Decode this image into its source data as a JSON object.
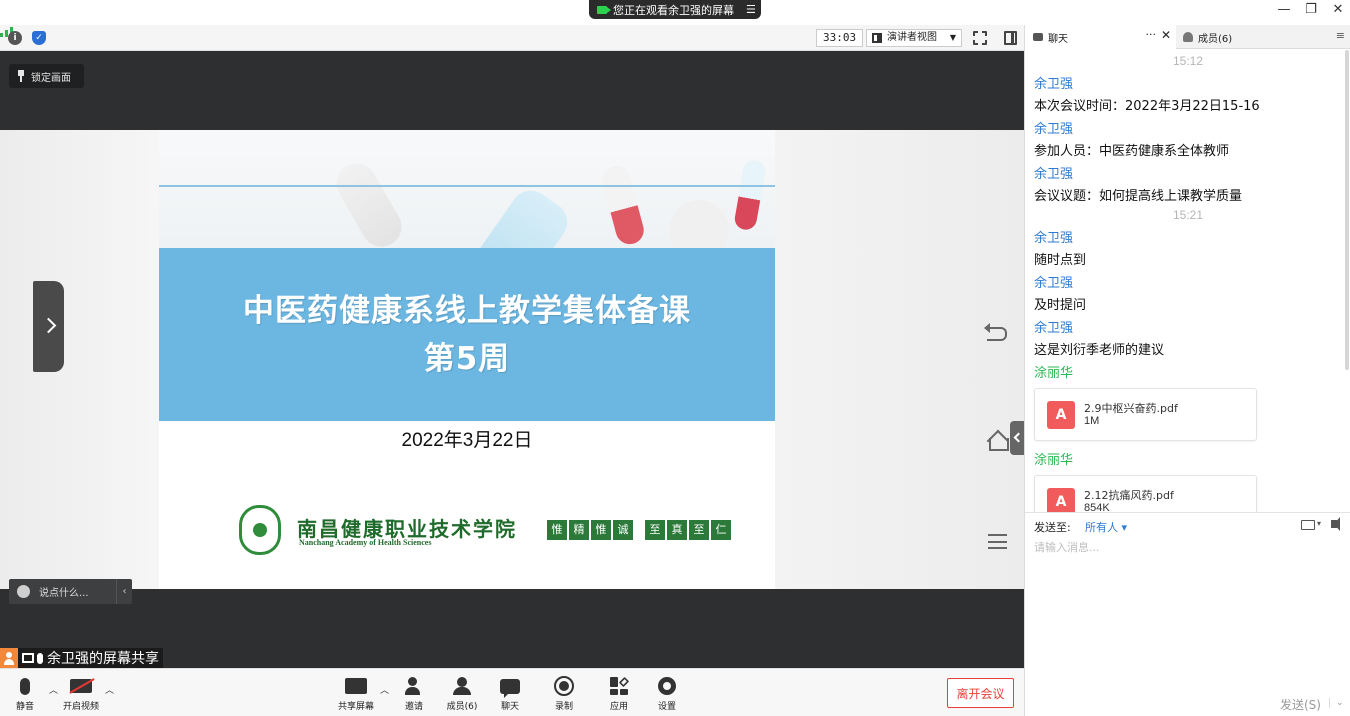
{
  "titlebar": {
    "viewing_text": "您正在观看余卫强的屏幕",
    "minimize": "—",
    "restore": "❐",
    "close": "✕"
  },
  "toolbar": {
    "timer": "33:03",
    "view_mode": "演讲者视图"
  },
  "share": {
    "pin_label": "锁定画面",
    "slide": {
      "title_line1": "中医药健康系线上教学集体备课",
      "title_line2": "第5周",
      "date": "2022年3月22日",
      "school_cn": "南昌健康职业技术学院",
      "school_en": "Nanchang Academy of Health Sciences",
      "motto": [
        "惟",
        "精",
        "惟",
        "诚",
        "至",
        "真",
        "至",
        "仁"
      ]
    },
    "say_placeholder": "说点什么...",
    "sharer_label": "余卫强的屏幕共享"
  },
  "bottom": {
    "mute": "静音",
    "start_video": "开启视频",
    "share_screen": "共享屏幕",
    "invite": "邀请",
    "members": "成员(6)",
    "chat": "聊天",
    "record": "录制",
    "apps": "应用",
    "settings": "设置",
    "leave": "离开会议"
  },
  "chat_panel": {
    "tab_chat": "聊天",
    "tab_members": "成员(6)",
    "items": [
      {
        "kind": "time",
        "text": "15:12"
      },
      {
        "kind": "sender",
        "text": "余卫强"
      },
      {
        "kind": "msg",
        "text": "本次会议时间：2022年3月22日15-16"
      },
      {
        "kind": "sender",
        "text": "余卫强"
      },
      {
        "kind": "msg",
        "text": "参加人员：中医药健康系全体教师"
      },
      {
        "kind": "sender",
        "text": "余卫强"
      },
      {
        "kind": "msg",
        "text": "会议议题：如何提高线上课教学质量"
      },
      {
        "kind": "time",
        "text": "15:21"
      },
      {
        "kind": "sender",
        "text": "余卫强"
      },
      {
        "kind": "msg",
        "text": "随时点到"
      },
      {
        "kind": "sender",
        "text": "余卫强"
      },
      {
        "kind": "msg",
        "text": "及时提问"
      },
      {
        "kind": "sender",
        "text": "余卫强"
      },
      {
        "kind": "msg",
        "text": "这是刘衍季老师的建议"
      },
      {
        "kind": "sender",
        "text": "涂丽华"
      },
      {
        "kind": "file",
        "name": "2.9中枢兴奋药.pdf",
        "size": "1M"
      },
      {
        "kind": "sender",
        "text": "涂丽华"
      },
      {
        "kind": "file",
        "name": "2.12抗痛风药.pdf",
        "size": "854K"
      }
    ],
    "send_to_label": "发送至:",
    "send_to_value": "所有人",
    "input_placeholder": "请输入消息...",
    "send_button": "发送(S)"
  },
  "colors": {
    "accent_blue": "#2e7bd1",
    "sender_green": "#2eb854",
    "leave_red": "#e5413b",
    "slide_band": "#6cb7e2"
  }
}
